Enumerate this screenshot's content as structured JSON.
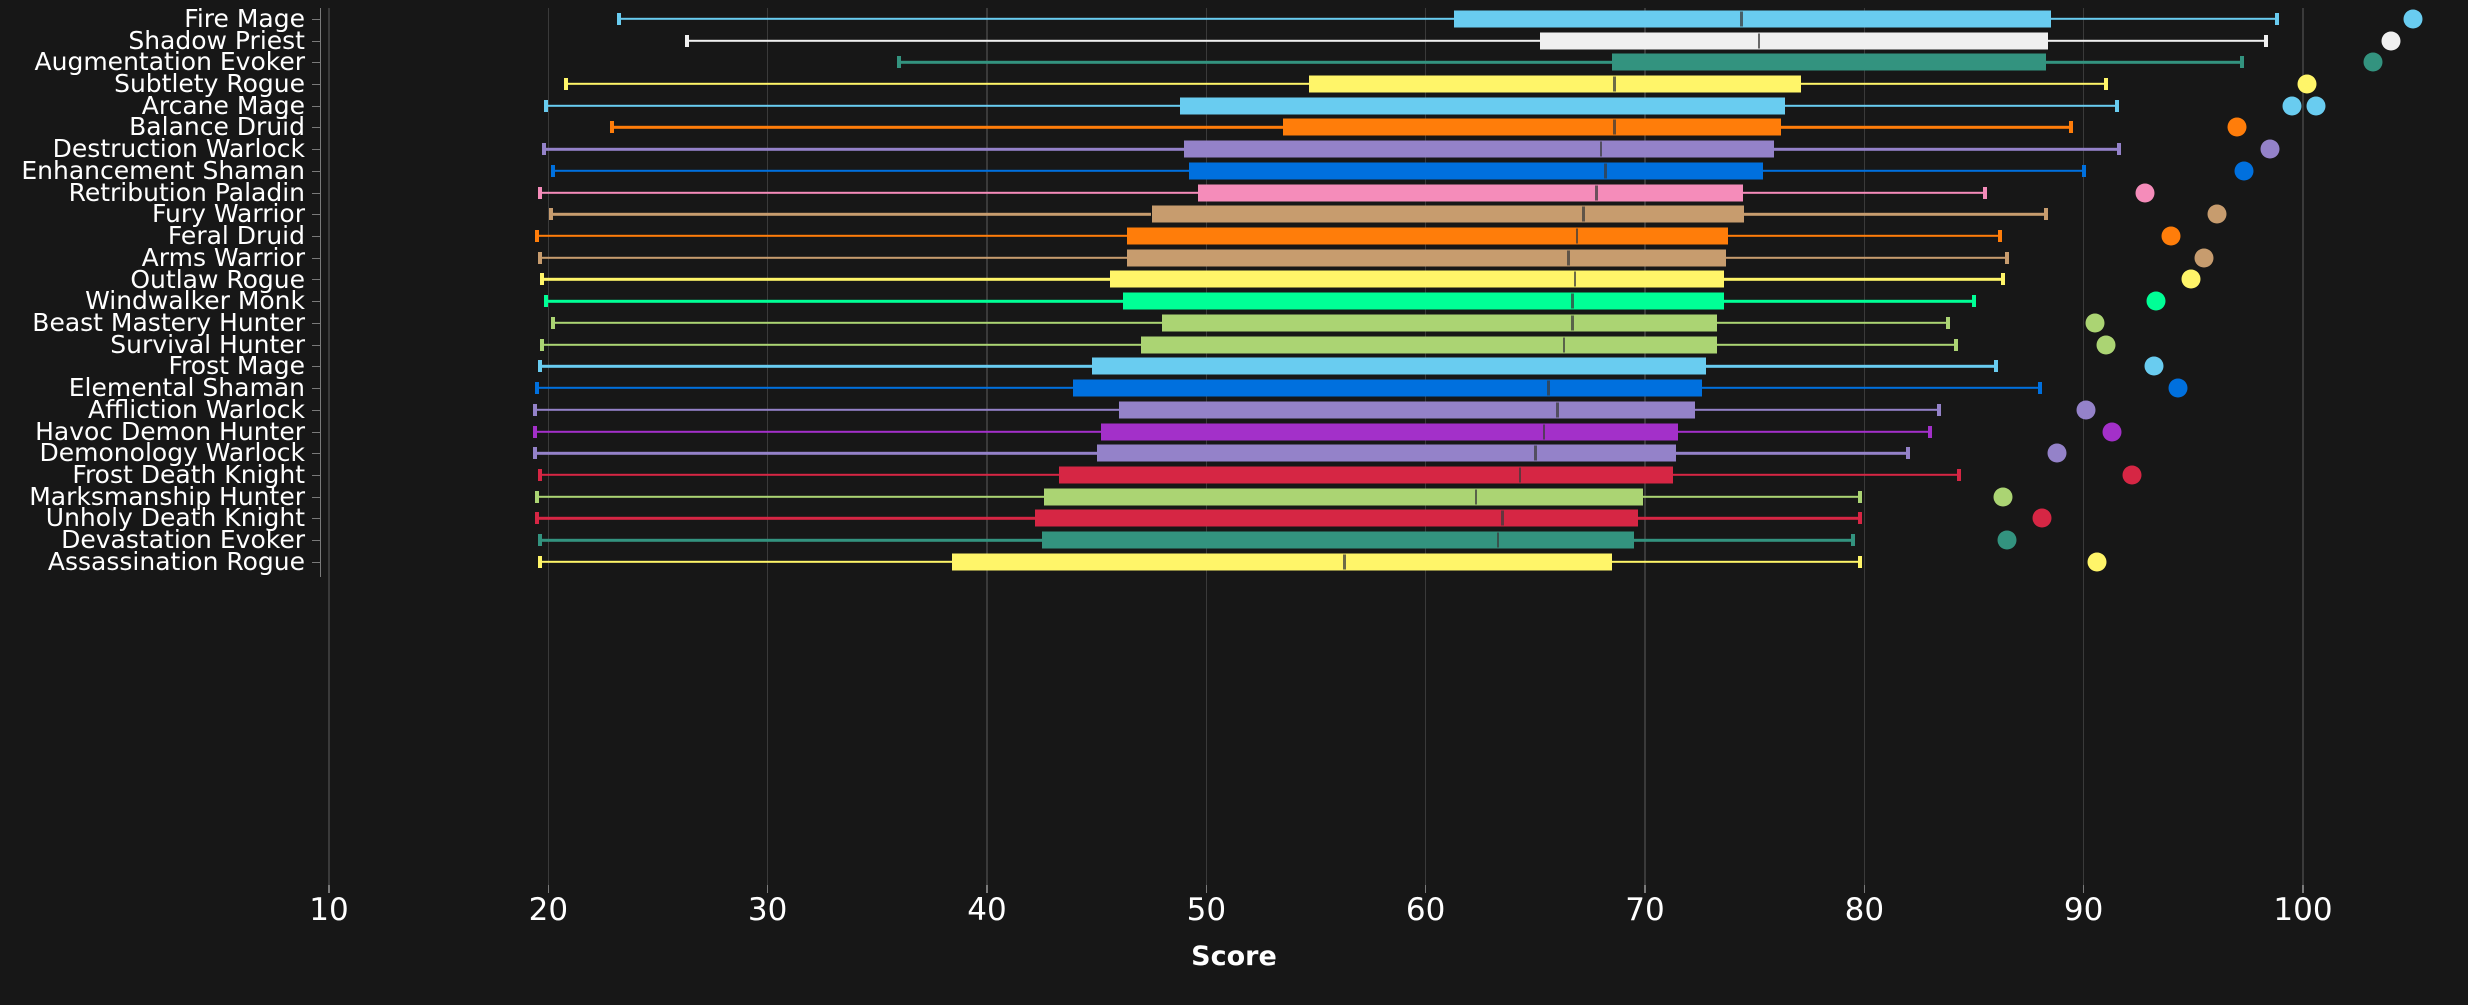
{
  "chart": {
    "type": "box",
    "background": "#171717",
    "axis": {
      "x_title": "Score",
      "x_ticks": [
        10,
        20,
        30,
        40,
        50,
        60,
        70,
        80,
        90,
        100
      ],
      "xlim": [
        8.5,
        103.5
      ],
      "grid": "vertical",
      "grid_color": "#3a3a3a",
      "tick_color": "#7a7a7a",
      "text_color": "#ffffff"
    }
  },
  "chart_data": {
    "type": "box",
    "title": "",
    "xlabel": "Score",
    "ylabel": "",
    "xlim": [
      8.5,
      103.5
    ],
    "categories": [
      "Fire Mage",
      "Shadow Priest",
      "Augmentation Evoker",
      "Subtlety Rogue",
      "Arcane Mage",
      "Balance Druid",
      "Destruction Warlock",
      "Enhancement Shaman",
      "Retribution Paladin",
      "Fury Warrior",
      "Feral Druid",
      "Arms Warrior",
      "Outlaw Rogue",
      "Windwalker Monk",
      "Beast Mastery Hunter",
      "Survival Hunter",
      "Frost Mage",
      "Elemental Shaman",
      "Affliction Warlock",
      "Havoc Demon Hunter",
      "Demonology Warlock",
      "Frost Death Knight",
      "Marksmanship Hunter",
      "Unholy Death Knight",
      "Devastation Evoker",
      "Assassination Rogue"
    ],
    "boxes": [
      {
        "label": "Fire Mage",
        "color": "#69ccf0",
        "whisker_low": 23.2,
        "q1": 61.3,
        "median": 74.4,
        "q3": 88.4,
        "whisker_high": 98.8,
        "outliers": [
          105.0
        ]
      },
      {
        "label": "Shadow Priest",
        "color": "#f0f0f0",
        "whisker_low": 26.3,
        "q1": 65.2,
        "median": 75.2,
        "q3": 88.3,
        "whisker_high": 98.3,
        "outliers": [
          104.0
        ]
      },
      {
        "label": "Augmentation Evoker",
        "color": "#33937f",
        "whisker_low": 36.0,
        "q1": 68.5,
        "median": null,
        "q3": 88.2,
        "whisker_high": 97.2,
        "outliers": [
          103.2
        ]
      },
      {
        "label": "Subtlety Rogue",
        "color": "#fff569",
        "whisker_low": 20.8,
        "q1": 54.7,
        "median": 68.6,
        "q3": 77.0,
        "whisker_high": 91.0,
        "outliers": [
          100.2
        ]
      },
      {
        "label": "Arcane Mage",
        "color": "#69ccf0",
        "whisker_low": 19.9,
        "q1": 48.8,
        "median": null,
        "q3": 76.3,
        "whisker_high": 91.5,
        "outliers": [
          100.6,
          99.5
        ]
      },
      {
        "label": "Balance Druid",
        "color": "#ff7d0a",
        "whisker_low": 22.9,
        "q1": 53.5,
        "median": 68.6,
        "q3": 76.1,
        "whisker_high": 89.4,
        "outliers": [
          97.0
        ]
      },
      {
        "label": "Destruction Warlock",
        "color": "#9482c9",
        "whisker_low": 19.8,
        "q1": 49.0,
        "median": 68.0,
        "q3": 75.8,
        "whisker_high": 91.6,
        "outliers": [
          98.5
        ]
      },
      {
        "label": "Enhancement Shaman",
        "color": "#0070de",
        "whisker_low": 20.2,
        "q1": 49.2,
        "median": 68.2,
        "q3": 75.3,
        "whisker_high": 90.0,
        "outliers": [
          97.3
        ]
      },
      {
        "label": "Retribution Paladin",
        "color": "#f58cba",
        "whisker_low": 19.6,
        "q1": 49.6,
        "median": 67.8,
        "q3": 74.4,
        "whisker_high": 85.5,
        "outliers": [
          92.8
        ]
      },
      {
        "label": "Fury Warrior",
        "color": "#c79c6e",
        "whisker_low": 20.1,
        "q1": 47.5,
        "median": 67.2,
        "q3": 74.4,
        "whisker_high": 88.3,
        "outliers": [
          96.1
        ]
      },
      {
        "label": "Feral Druid",
        "color": "#ff7d0a",
        "whisker_low": 19.5,
        "q1": 46.4,
        "median": 66.9,
        "q3": 73.7,
        "whisker_high": 86.2,
        "outliers": [
          94.0
        ]
      },
      {
        "label": "Arms Warrior",
        "color": "#c79c6e",
        "whisker_low": 19.6,
        "q1": 46.4,
        "median": 66.5,
        "q3": 73.6,
        "whisker_high": 86.5,
        "outliers": [
          95.5
        ]
      },
      {
        "label": "Outlaw Rogue",
        "color": "#fff569",
        "whisker_low": 19.7,
        "q1": 45.6,
        "median": 66.8,
        "q3": 73.5,
        "whisker_high": 86.3,
        "outliers": [
          94.9
        ]
      },
      {
        "label": "Windwalker Monk",
        "color": "#00ff96",
        "whisker_low": 19.9,
        "q1": 46.2,
        "median": 66.7,
        "q3": 73.5,
        "whisker_high": 85.0,
        "outliers": [
          93.3
        ]
      },
      {
        "label": "Beast Mastery Hunter",
        "color": "#abd473",
        "whisker_low": 20.2,
        "q1": 48.0,
        "median": 66.7,
        "q3": 73.2,
        "whisker_high": 83.8,
        "outliers": [
          90.5
        ]
      },
      {
        "label": "Survival Hunter",
        "color": "#abd473",
        "whisker_low": 19.7,
        "q1": 47.0,
        "median": 66.3,
        "q3": 73.2,
        "whisker_high": 84.2,
        "outliers": [
          91.0
        ]
      },
      {
        "label": "Frost Mage",
        "color": "#69ccf0",
        "whisker_low": 19.6,
        "q1": 44.8,
        "median": null,
        "q3": 72.7,
        "whisker_high": 86.0,
        "outliers": [
          93.2
        ]
      },
      {
        "label": "Elemental Shaman",
        "color": "#0070de",
        "whisker_low": 19.5,
        "q1": 43.9,
        "median": 65.6,
        "q3": 72.5,
        "whisker_high": 88.0,
        "outliers": [
          94.3
        ]
      },
      {
        "label": "Affliction Warlock",
        "color": "#9482c9",
        "whisker_low": 19.4,
        "q1": 46.0,
        "median": 66.0,
        "q3": 72.2,
        "whisker_high": 83.4,
        "outliers": [
          90.1
        ]
      },
      {
        "label": "Havoc Demon Hunter",
        "color": "#a330c9",
        "whisker_low": 19.4,
        "q1": 45.2,
        "median": 65.4,
        "q3": 71.4,
        "whisker_high": 83.0,
        "outliers": [
          91.3
        ]
      },
      {
        "label": "Demonology Warlock",
        "color": "#9482c9",
        "whisker_low": 19.4,
        "q1": 45.0,
        "median": 65.0,
        "q3": 71.3,
        "whisker_high": 82.0,
        "outliers": [
          88.8
        ]
      },
      {
        "label": "Frost Death Knight",
        "color": "#d62644",
        "whisker_low": 19.6,
        "q1": 43.3,
        "median": 64.3,
        "q3": 71.2,
        "whisker_high": 84.3,
        "outliers": [
          92.2
        ]
      },
      {
        "label": "Marksmanship Hunter",
        "color": "#abd473",
        "whisker_low": 19.5,
        "q1": 42.6,
        "median": 62.3,
        "q3": 69.8,
        "whisker_high": 79.8,
        "outliers": [
          86.3
        ]
      },
      {
        "label": "Unholy Death Knight",
        "color": "#d62644",
        "whisker_low": 19.5,
        "q1": 42.2,
        "median": 63.5,
        "q3": 69.6,
        "whisker_high": 79.8,
        "outliers": [
          88.1
        ]
      },
      {
        "label": "Devastation Evoker",
        "color": "#33937f",
        "whisker_low": 19.6,
        "q1": 42.5,
        "median": 63.3,
        "q3": 69.4,
        "whisker_high": 79.5,
        "outliers": [
          86.5
        ]
      },
      {
        "label": "Assassination Rogue",
        "color": "#fff569",
        "whisker_low": 19.6,
        "q1": 38.4,
        "median": 56.3,
        "q3": 68.4,
        "whisker_high": 79.8,
        "outliers": [
          90.6
        ]
      }
    ]
  }
}
